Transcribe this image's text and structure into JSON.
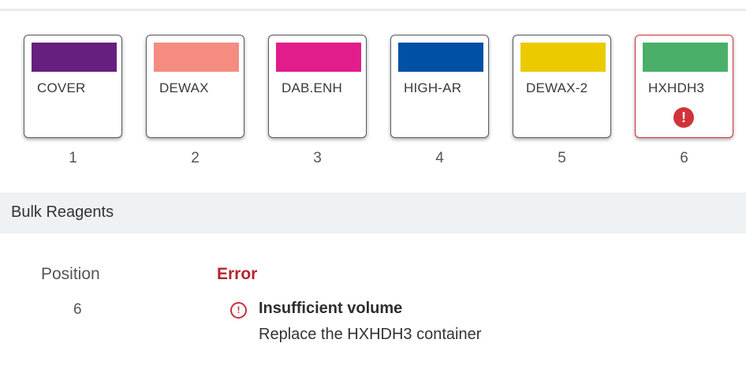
{
  "reagent_slots": [
    {
      "name": "COVER",
      "position": "1",
      "color": "#65207f",
      "error": false
    },
    {
      "name": "DEWAX",
      "position": "2",
      "color": "#f48c82",
      "error": false
    },
    {
      "name": "DAB.ENH",
      "position": "3",
      "color": "#e21c8a",
      "error": false
    },
    {
      "name": "HIGH-AR",
      "position": "4",
      "color": "#0050a6",
      "error": false
    },
    {
      "name": "DEWAX-2",
      "position": "5",
      "color": "#ebcb00",
      "error": false
    },
    {
      "name": "HXHDH3",
      "position": "6",
      "color": "#4aaf68",
      "error": true,
      "icon": "exclamation-circle-icon"
    }
  ],
  "bulk_reagents": {
    "title": "Bulk Reagents"
  },
  "details": {
    "position_label": "Position",
    "position_value": "6",
    "error_label": "Error",
    "message_icon": "warning-circle-icon",
    "message_title": "Insufficient volume",
    "message_detail": "Replace the HXHDH3 container"
  },
  "colors": {
    "error_red": "#b5242e",
    "header_bg": "#eef2f4"
  }
}
